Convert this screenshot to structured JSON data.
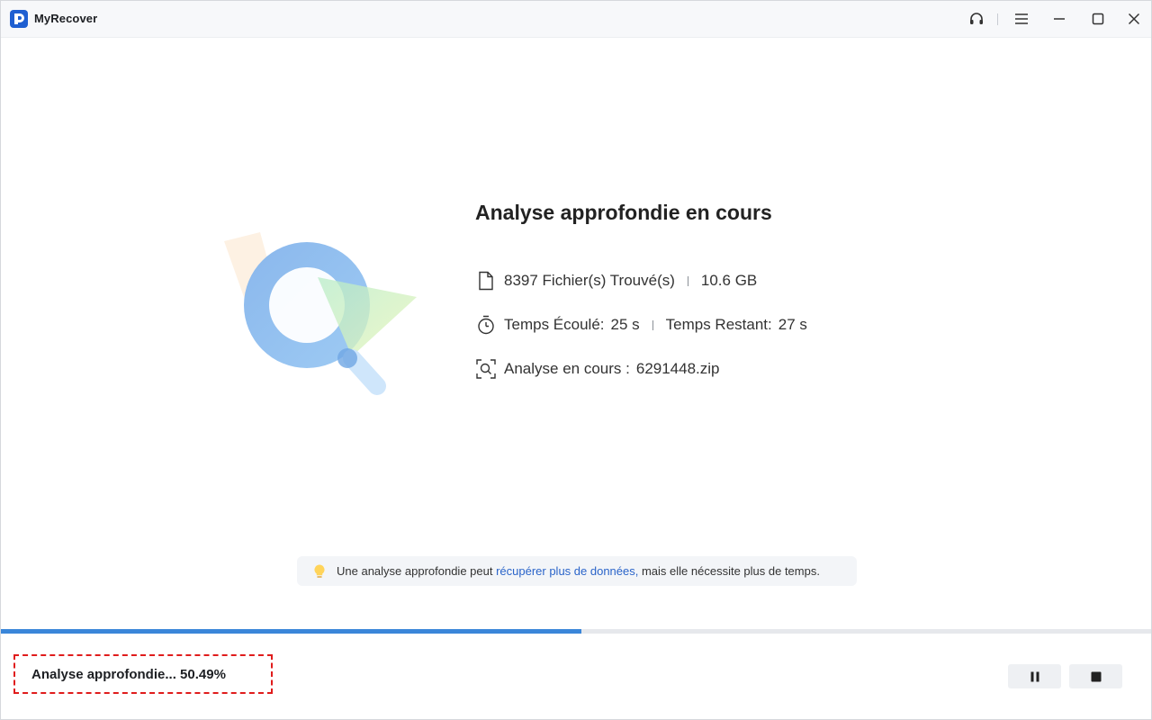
{
  "app": {
    "title": "MyRecover"
  },
  "titlebar": {
    "icons": [
      "headset-icon",
      "menu-icon",
      "minimize-icon",
      "maximize-icon",
      "close-icon"
    ]
  },
  "scan": {
    "heading": "Analyse approfondie en cours",
    "files_found": "8397 Fichier(s) Trouvé(s)",
    "size": "10.6 GB",
    "elapsed_label": "Temps Écoulé:",
    "elapsed_value": "25 s",
    "remaining_label": "Temps Restant:",
    "remaining_value": "27 s",
    "current_label": "Analyse en cours :",
    "current_file": "6291448.zip"
  },
  "tip": {
    "text_before": "Une analyse approfondie peut ",
    "link_text": "récupérer plus de données,",
    "text_after": " mais elle nécessite plus de temps."
  },
  "progress": {
    "percent": 50.49
  },
  "status": {
    "text": "Analyse approfondie... 50.49%"
  },
  "controls": {
    "icons": [
      "pause-icon",
      "stop-icon"
    ]
  },
  "colors": {
    "accent": "#3a86d9",
    "link": "#2a64c9",
    "highlight_border": "#e01c1c"
  }
}
